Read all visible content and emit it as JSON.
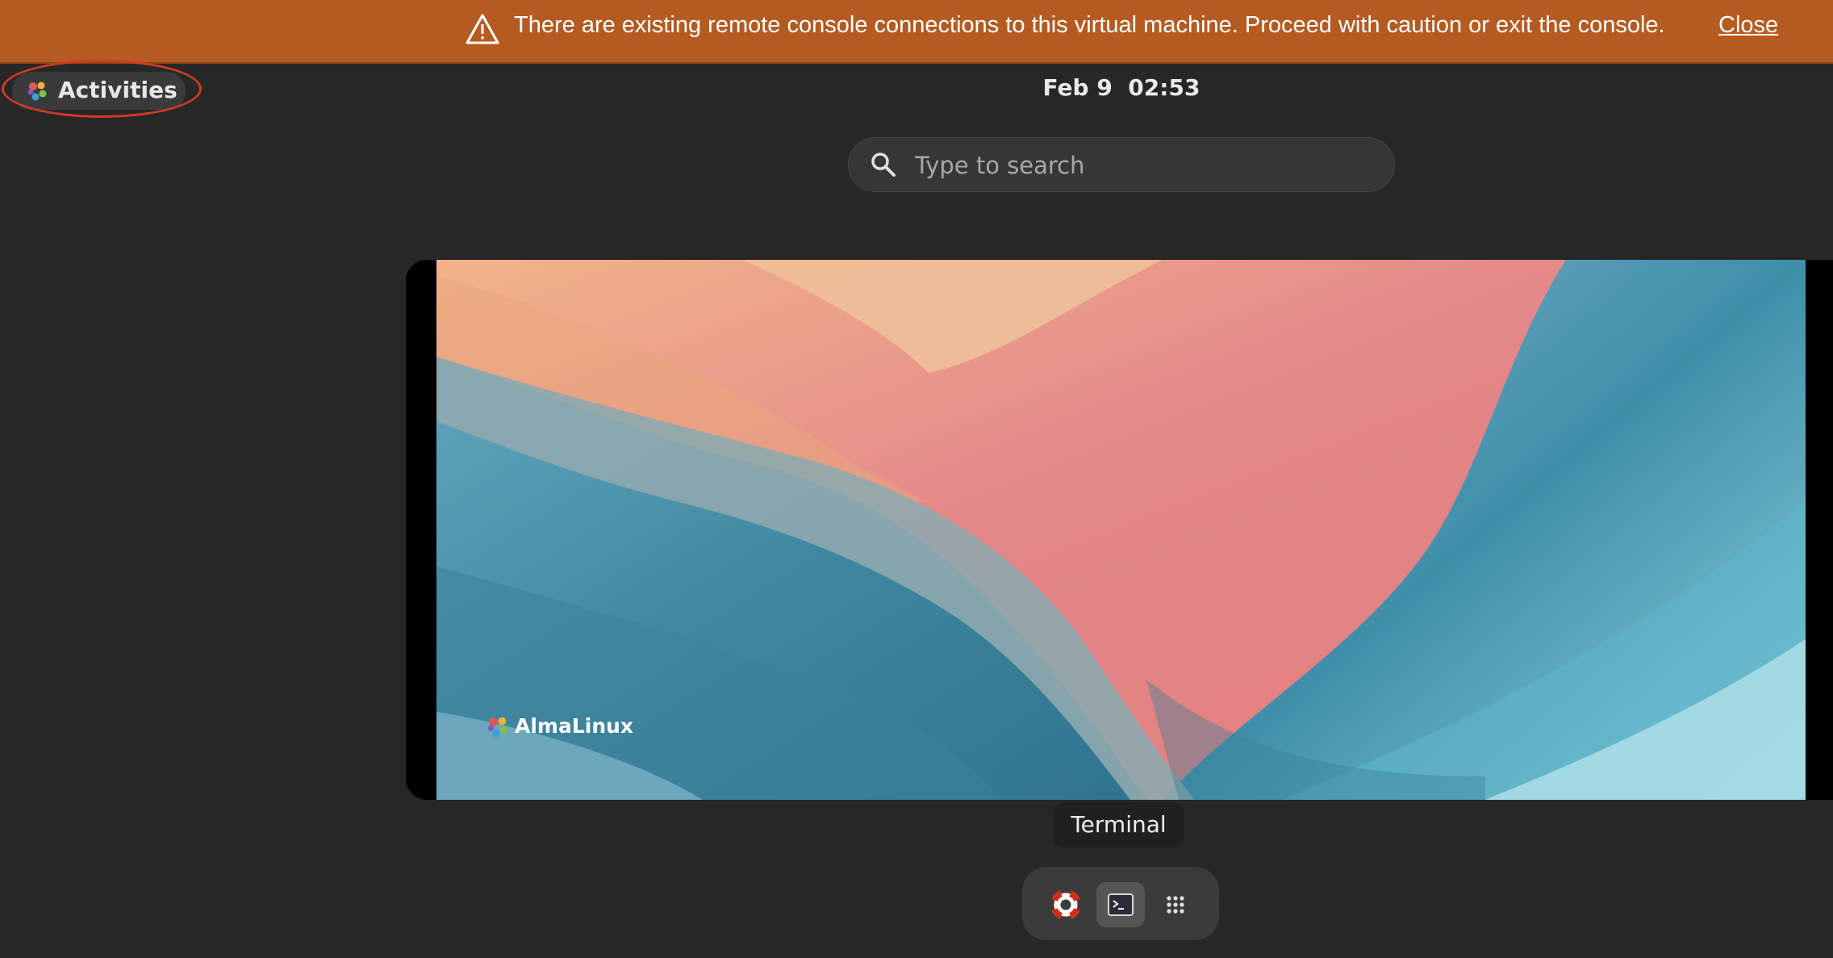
{
  "banner": {
    "message": "There are existing remote console connections to this virtual machine. Proceed with caution or exit the console.",
    "close_label": "Close",
    "icon": "warning-icon",
    "color": "#b55b22"
  },
  "top_bar": {
    "activities_label": "Activities",
    "logo_icon": "almalinux-logo-icon",
    "clock": "Feb 9  02:53"
  },
  "search": {
    "placeholder": "Type to search",
    "icon": "search-icon"
  },
  "workspace": {
    "wallpaper_brand": "AlmaLinux"
  },
  "tooltip": {
    "label": "Terminal"
  },
  "dock": {
    "items": [
      {
        "name": "help",
        "icon": "lifebuoy-icon",
        "active": false
      },
      {
        "name": "terminal",
        "icon": "terminal-icon",
        "active": true
      },
      {
        "name": "show-apps",
        "icon": "app-grid-icon",
        "active": false
      }
    ]
  },
  "colors": {
    "background": "#272727",
    "annotation": "#d33a22"
  }
}
